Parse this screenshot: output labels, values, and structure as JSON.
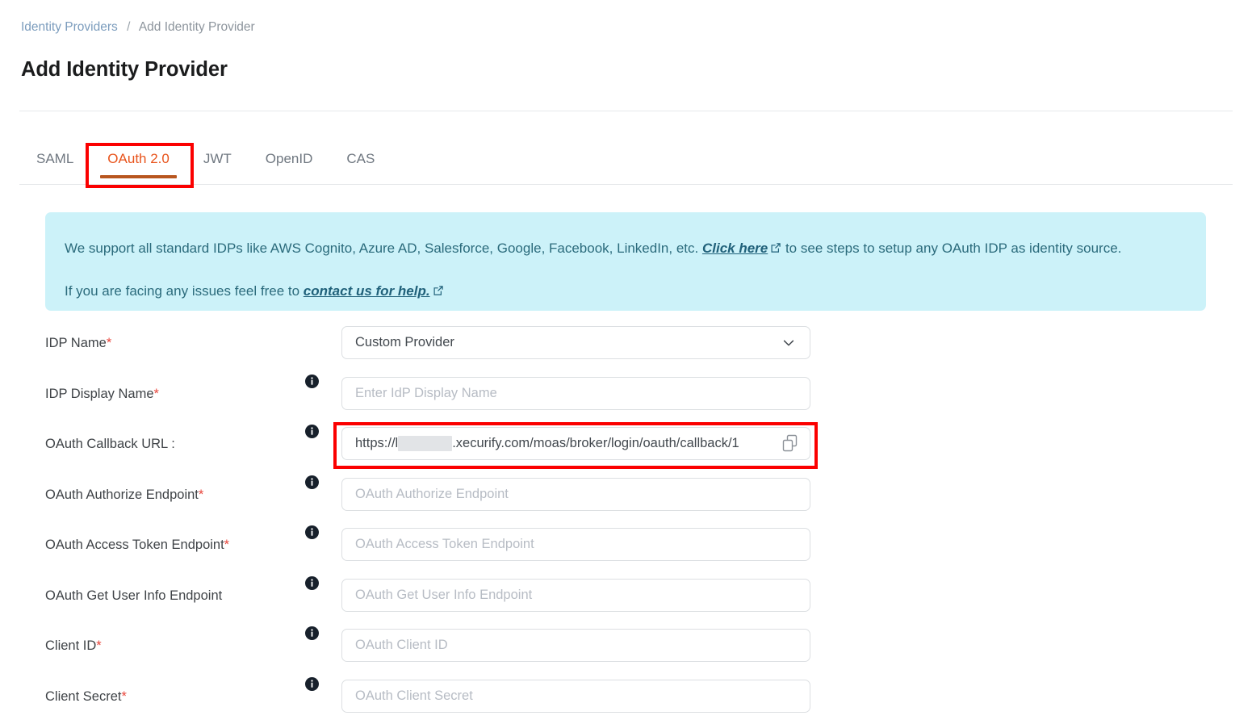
{
  "breadcrumb": {
    "parent": "Identity Providers",
    "separator": "/",
    "current": "Add Identity Provider"
  },
  "page_title": "Add Identity Provider",
  "tabs": [
    {
      "label": "SAML",
      "active": false
    },
    {
      "label": "OAuth 2.0",
      "active": true
    },
    {
      "label": "JWT",
      "active": false
    },
    {
      "label": "OpenID",
      "active": false
    },
    {
      "label": "CAS",
      "active": false
    }
  ],
  "banner": {
    "line1_prefix": "We support all standard IDPs like AWS Cognito, Azure AD, Salesforce, Google, Facebook, LinkedIn, etc. ",
    "line1_link": "Click here",
    "line1_suffix": " to see steps to setup any OAuth IDP as identity source.",
    "line2_prefix": "If you are facing any issues feel free to ",
    "line2_link": "contact us for help.",
    "line2_suffix": "",
    "background_color": "#ccf2f9",
    "text_color": "#2b6b7c"
  },
  "form": {
    "idp_name": {
      "label": "IDP Name",
      "required": true,
      "value": "Custom Provider",
      "has_info": false
    },
    "idp_display_name": {
      "label": "IDP Display Name",
      "required": true,
      "placeholder": "Enter IdP Display Name",
      "has_info": true
    },
    "oauth_callback_url": {
      "label": "OAuth Callback URL :",
      "required": false,
      "value_prefix": "https://l",
      "value_suffix": ".xecurify.com/moas/broker/login/oauth/callback/1",
      "redacted": true,
      "has_info": true
    },
    "oauth_authorize_endpoint": {
      "label": "OAuth Authorize Endpoint",
      "required": true,
      "placeholder": "OAuth Authorize Endpoint",
      "has_info": true
    },
    "oauth_access_token_endpoint": {
      "label": "OAuth Access Token Endpoint",
      "required": true,
      "placeholder": "OAuth Access Token Endpoint",
      "has_info": true
    },
    "oauth_get_user_info_endpoint": {
      "label": "OAuth Get User Info Endpoint",
      "required": false,
      "placeholder": "OAuth Get User Info Endpoint",
      "has_info": true
    },
    "client_id": {
      "label": "Client ID",
      "required": true,
      "placeholder": "OAuth Client ID",
      "has_info": true
    },
    "client_secret": {
      "label": "Client Secret",
      "required": true,
      "placeholder": "OAuth Client Secret",
      "has_info": true
    }
  },
  "annotations": {
    "color": "#fb0000",
    "targets": [
      "oauth-2-tab",
      "oauth-callback-url-field"
    ]
  },
  "colors": {
    "accent_tab": "#e8531b",
    "tab_underline": "#b8561f",
    "required_asterisk": "#e8463c",
    "breadcrumb_link": "#7b9cbd"
  }
}
